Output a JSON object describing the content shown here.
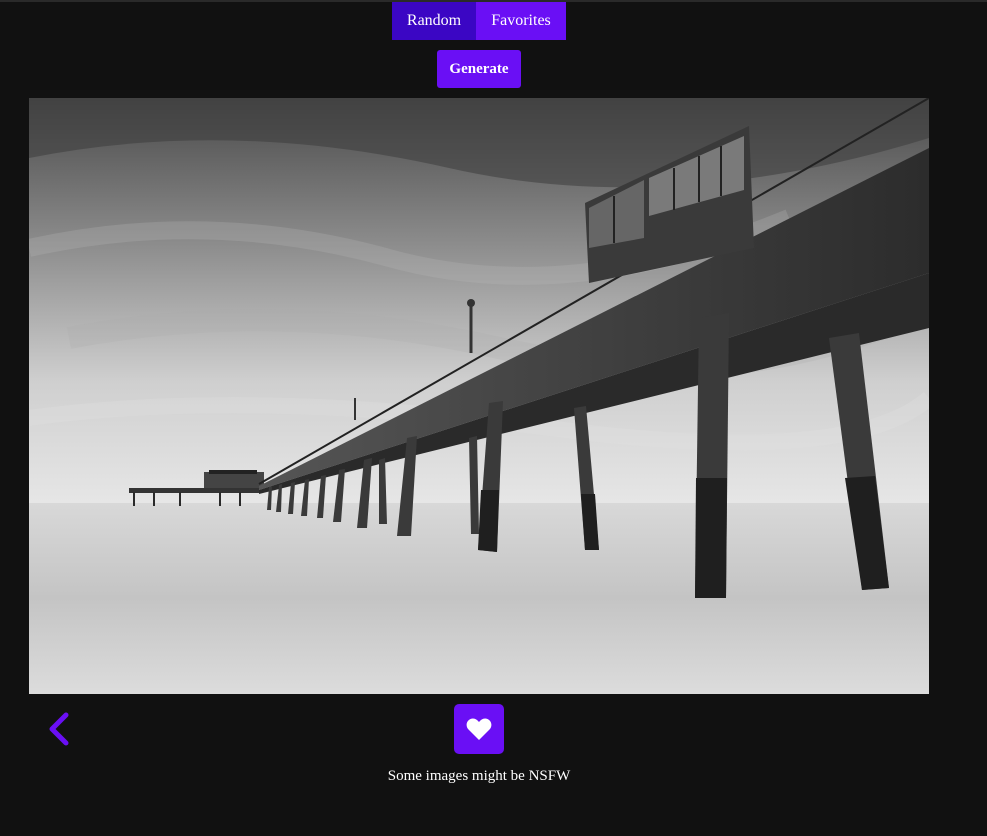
{
  "nav": {
    "tabs": [
      {
        "label": "Random",
        "active": true
      },
      {
        "label": "Favorites",
        "active": false
      }
    ]
  },
  "actions": {
    "generate_label": "Generate"
  },
  "image": {
    "alt": "Pier"
  },
  "controls": {
    "back_icon": "chevron-left-icon",
    "favorite_icon": "heart-icon"
  },
  "footer": {
    "notice": "Some images might be NSFW"
  },
  "colors": {
    "background": "#111111",
    "accent": "#6a0ff5",
    "accent_dark": "#3b06c4"
  }
}
